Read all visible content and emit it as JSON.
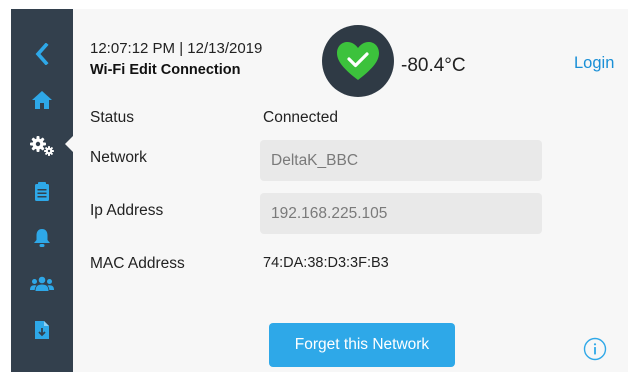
{
  "header": {
    "datetime": "12:07:12 PM | 12/13/2019",
    "screen_title": "Wi-Fi Edit Connection",
    "temperature": "-80.4°C",
    "login_label": "Login",
    "status_icon": "heart-check-icon"
  },
  "sidebar": {
    "items": [
      {
        "name": "back",
        "icon": "chevron-left-icon"
      },
      {
        "name": "home",
        "icon": "home-icon"
      },
      {
        "name": "settings",
        "icon": "gear-icon",
        "active": true
      },
      {
        "name": "logs",
        "icon": "clipboard-icon"
      },
      {
        "name": "alarms",
        "icon": "bell-icon"
      },
      {
        "name": "users",
        "icon": "users-icon"
      },
      {
        "name": "reports",
        "icon": "document-download-icon"
      }
    ]
  },
  "form": {
    "status_label": "Status",
    "status_value": "Connected",
    "network_label": "Network",
    "network_value": "DeltaK_BBC",
    "ip_label": "Ip Address",
    "ip_value": "192.168.225.105",
    "mac_label": "MAC Address",
    "mac_value": "74:DA:38:D3:3F:B3"
  },
  "actions": {
    "forget_label": "Forget this Network",
    "info_icon": "info-icon"
  },
  "colors": {
    "sidebar": "#33404d",
    "sidebar_icon": "#2ea8e8",
    "accent": "#2ea8e8",
    "status_ok": "#3cc23c",
    "background": "#f7f7f7",
    "field": "#e9e9e9"
  }
}
